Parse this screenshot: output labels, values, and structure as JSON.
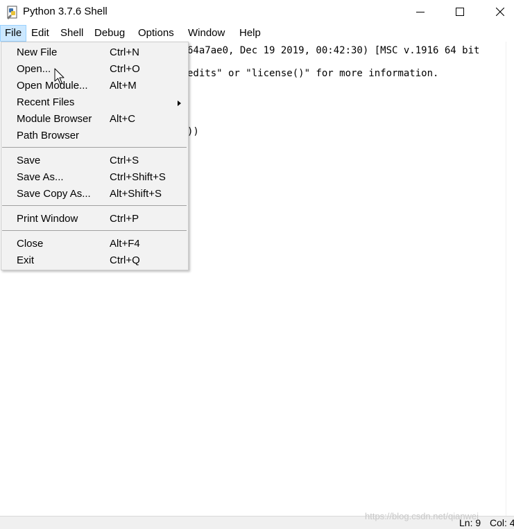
{
  "window": {
    "title": "Python 3.7.6 Shell"
  },
  "menubar": {
    "items": [
      {
        "label": "File",
        "active": true
      },
      {
        "label": "Edit"
      },
      {
        "label": "Shell"
      },
      {
        "label": "Debug"
      },
      {
        "label": "Options"
      },
      {
        "label": "Window"
      },
      {
        "label": "Help"
      }
    ]
  },
  "shell": {
    "lines": [
      "64a7ae0, Dec 19 2019, 00:42:30) [MSC v.1916 64 bit",
      "edits\" or \"license()\" for more information.",
      "))"
    ]
  },
  "file_menu": {
    "items": [
      {
        "label": "New File",
        "accel": "Ctrl+N"
      },
      {
        "label": "Open...",
        "accel": "Ctrl+O"
      },
      {
        "label": "Open Module...",
        "accel": "Alt+M"
      },
      {
        "label": "Recent Files",
        "accel": "",
        "submenu": true
      },
      {
        "label": "Module Browser",
        "accel": "Alt+C"
      },
      {
        "label": "Path Browser",
        "accel": ""
      },
      {
        "label": "Save",
        "accel": "Ctrl+S"
      },
      {
        "label": "Save As...",
        "accel": "Ctrl+Shift+S"
      },
      {
        "label": "Save Copy As...",
        "accel": "Alt+Shift+S"
      },
      {
        "label": "Print Window",
        "accel": "Ctrl+P"
      },
      {
        "label": "Close",
        "accel": "Alt+F4"
      },
      {
        "label": "Exit",
        "accel": "Ctrl+Q"
      }
    ]
  },
  "statusbar": {
    "ln": "Ln: 9",
    "col": "Col: 4"
  },
  "watermark": "https://blog.csdn.net/qianwei",
  "icons": {
    "app": "python-idle-icon",
    "minimize": "minimize-icon",
    "maximize": "maximize-icon",
    "close": "close-icon",
    "submenu": "submenu-arrow-icon",
    "cursor": "mouse-pointer-icon"
  },
  "colors": {
    "menu_active_bg": "#cce8ff",
    "menu_active_border": "#99d1ff",
    "dropdown_bg": "#f2f2f2"
  }
}
